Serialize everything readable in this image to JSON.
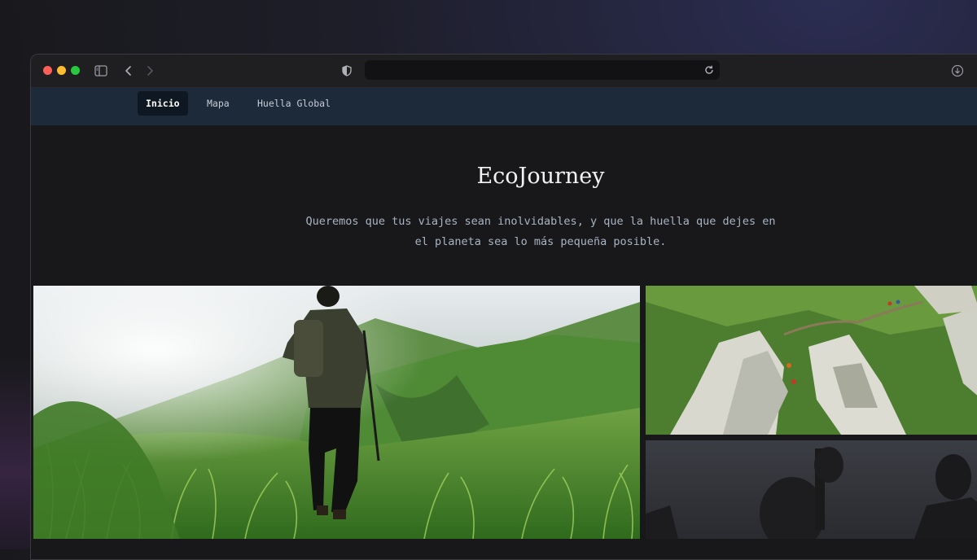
{
  "browser": {
    "address_text": ""
  },
  "nav": {
    "items": [
      {
        "label": "Inicio",
        "active": true
      },
      {
        "label": "Mapa",
        "active": false
      },
      {
        "label": "Huella Global",
        "active": false
      }
    ]
  },
  "hero": {
    "title": "EcoJourney",
    "subtitle_line1": "Queremos que tus viajes sean inolvidables, y que la huella que dejes en",
    "subtitle_line2": "el planeta sea lo más pequeña posible."
  },
  "icons": {
    "sidebar": "sidebar-icon",
    "back": "chevron-left-icon",
    "forward": "chevron-right-icon",
    "privacy": "shield-icon",
    "reload": "reload-icon",
    "download": "download-icon"
  },
  "colors": {
    "navbar_bg": "#1d2a3a",
    "page_bg": "#18181b",
    "title": "#f2f2f2",
    "subtitle": "#a8b4c2"
  }
}
